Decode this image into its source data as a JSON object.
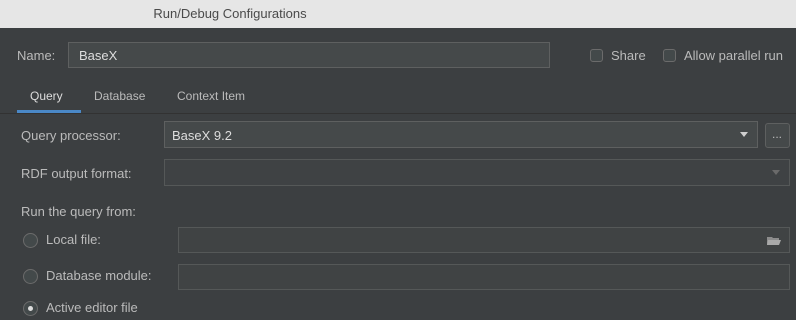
{
  "window": {
    "title": "Run/Debug Configurations"
  },
  "name_row": {
    "label": "Name:",
    "value": "BaseX",
    "share_label": "Share",
    "allow_parallel_label": "Allow parallel run"
  },
  "tabs": [
    {
      "label": "Query",
      "active": true
    },
    {
      "label": "Database",
      "active": false
    },
    {
      "label": "Context Item",
      "active": false
    }
  ],
  "query_processor": {
    "label": "Query processor:",
    "value": "BaseX 9.2",
    "browse_label": "..."
  },
  "rdf_output": {
    "label": "RDF output format:",
    "value": ""
  },
  "run_from": {
    "label": "Run the query from:",
    "options": [
      {
        "label": "Local file:",
        "selected": false
      },
      {
        "label": "Database module:",
        "selected": false
      },
      {
        "label": "Active editor file",
        "selected": true
      }
    ]
  },
  "icons": {
    "folder": "folder-icon",
    "dropdown": "chevron-down-icon"
  }
}
